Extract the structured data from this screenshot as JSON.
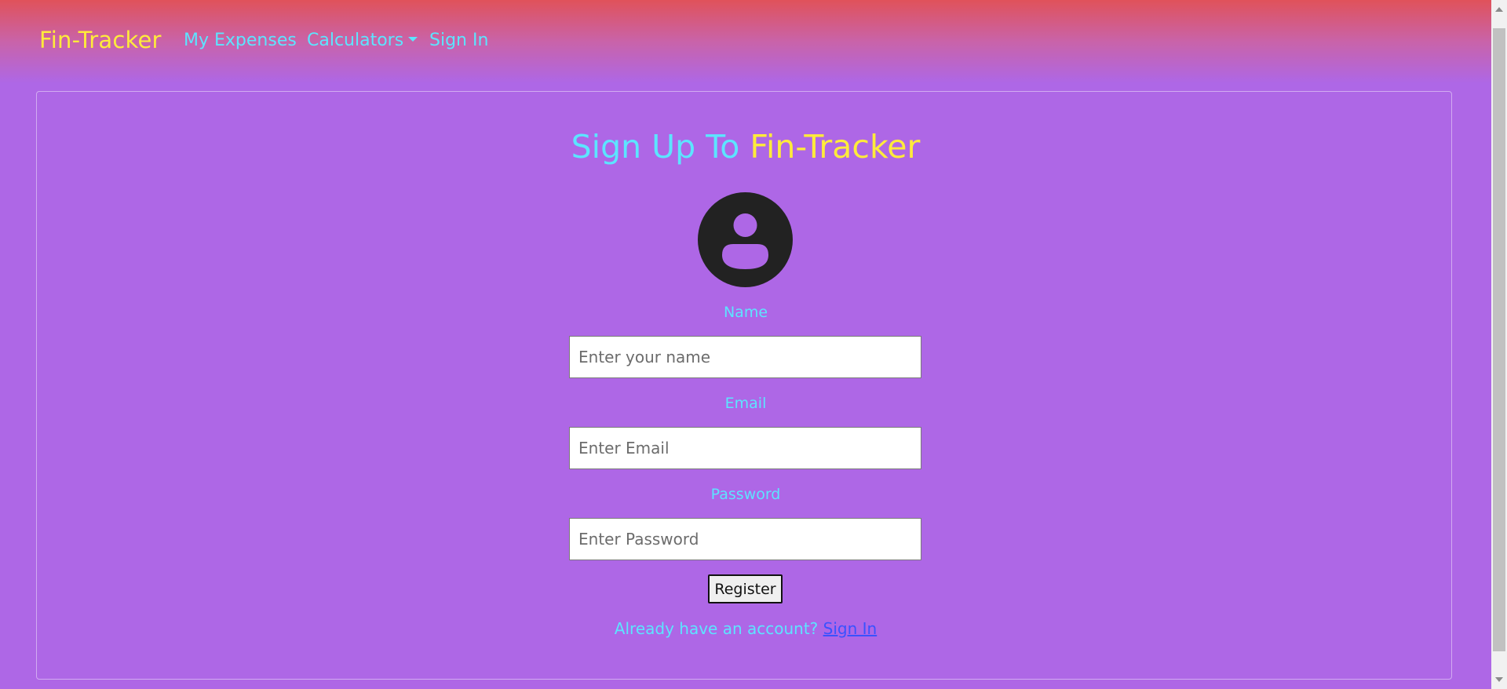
{
  "navbar": {
    "brand": "Fin-Tracker",
    "links": {
      "expenses": "My Expenses",
      "calculators": "Calculators",
      "signin": "Sign In"
    }
  },
  "signup": {
    "title_prefix": "Sign Up To",
    "title_brand": "Fin-Tracker",
    "avatar_icon": "user-circle-icon",
    "name_label": "Name",
    "name_placeholder": "Enter your name",
    "email_label": "Email",
    "email_placeholder": "Enter Email",
    "password_label": "Password",
    "password_placeholder": "Enter Password",
    "register_label": "Register",
    "footer_text": "Already have an account?",
    "footer_link": "Sign In"
  },
  "colors": {
    "background": "#ae67e6",
    "header_top": "#e0525a",
    "accent_cyan": "#5ce5ff",
    "accent_yellow": "#ffeb3b",
    "link_blue": "#3a52ff"
  }
}
